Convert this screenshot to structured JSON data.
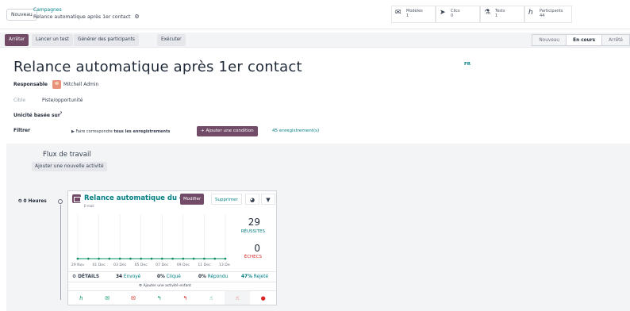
{
  "header": {
    "new_label": "Nouveau",
    "breadcrumb_parent": "Campagnes",
    "breadcrumb_current": "Relance automatique après 1er contact",
    "gear_glyph": "⚙"
  },
  "smart_buttons": [
    {
      "icon": "envelope-icon",
      "glyph": "✉",
      "label": "Modèles",
      "count": "1"
    },
    {
      "icon": "cursor-icon",
      "glyph": "➤",
      "label": "Clics",
      "count": "0"
    },
    {
      "icon": "flask-icon",
      "glyph": "⚗",
      "label": "Tests",
      "count": "1"
    },
    {
      "icon": "user-icon",
      "glyph": "ℎ",
      "label": "Participants",
      "count": "44"
    }
  ],
  "actions": {
    "stop": "Arrêter",
    "launch_test": "Lancer un test",
    "generate": "Générer des participants",
    "execute": "Exécuter"
  },
  "stages": [
    "Nouveau",
    "En cours",
    "Arrêté"
  ],
  "active_stage": "En cours",
  "form": {
    "title": "Relance automatique après 1er contact",
    "lang": "FR",
    "responsible_label": "Responsable",
    "responsible_value": "Mitchell Admin",
    "target_label": "Cible",
    "target_value": "Piste/opportunité",
    "unique_label": "Unicité basée sur",
    "unique_sup": "?",
    "filter_label": "Filtrer",
    "filter_prefix": "Faire correspondre",
    "filter_bold": "tous les enregistrements",
    "add_condition": "+ Ajouter une condition",
    "records": "45 enregistrement(s)"
  },
  "workflow": {
    "title": "Flux de travail",
    "add_activity": "Ajouter une nouvelle activité",
    "hours": "⏲ 0 Heures",
    "card": {
      "title": "Relance automatique du contact",
      "subtitle": "E-mail",
      "edit": "Modifier",
      "delete": "Supprimer",
      "pie_glyph": "◕",
      "filter_glyph": "▼",
      "success_count": "29",
      "success_label": "RÉUSSITES",
      "fail_count": "0",
      "fail_label": "ÉCHECS",
      "details": "⚙ DÉTAILS",
      "sent_num": "34",
      "sent_lbl": "Envoyé",
      "clicked_num": "0%",
      "clicked_lbl": "Cliqué",
      "replied_num": "0%",
      "replied_lbl": "Répondu",
      "rejected_num": "47%",
      "rejected_lbl": "Rejeté",
      "add_child": "⚙ Ajouter une activité enfant",
      "child_icons": [
        {
          "name": "cursor-icon",
          "glyph": "ℎ",
          "tone": "green"
        },
        {
          "name": "mail-open-icon",
          "glyph": "✉",
          "tone": "green"
        },
        {
          "name": "mail-closed-icon",
          "glyph": "✉",
          "tone": "red"
        },
        {
          "name": "reply-icon",
          "glyph": "↰",
          "tone": "green"
        },
        {
          "name": "no-reply-icon",
          "glyph": "↰",
          "tone": "red"
        },
        {
          "name": "thumbs-up-icon",
          "glyph": "☝",
          "tone": "green"
        },
        {
          "name": "thumbs-down-icon",
          "glyph": "☝",
          "tone": "red"
        },
        {
          "name": "bounce-icon",
          "glyph": "●",
          "tone": "red"
        }
      ]
    }
  },
  "chart_data": {
    "type": "line",
    "categories": [
      "29 Nov",
      "01 Dec",
      "03 Dec",
      "05 Dec",
      "07 Dec",
      "09 Dec",
      "11 Dec",
      "13 Dec"
    ],
    "series": [
      {
        "name": "",
        "color": "#059669",
        "values": [
          0,
          0,
          0,
          0,
          0,
          0,
          0,
          0,
          0,
          0,
          0,
          0,
          0,
          0,
          0
        ]
      },
      {
        "name": "",
        "color": "#dc2626",
        "values": [
          0,
          0,
          0,
          0,
          0,
          0,
          0,
          0,
          0,
          0,
          0,
          0,
          0,
          0,
          0
        ]
      }
    ],
    "grid": true
  },
  "colors": {
    "primary": "#714b67",
    "link": "#017e84",
    "success": "#059669",
    "danger": "#dc2626"
  }
}
